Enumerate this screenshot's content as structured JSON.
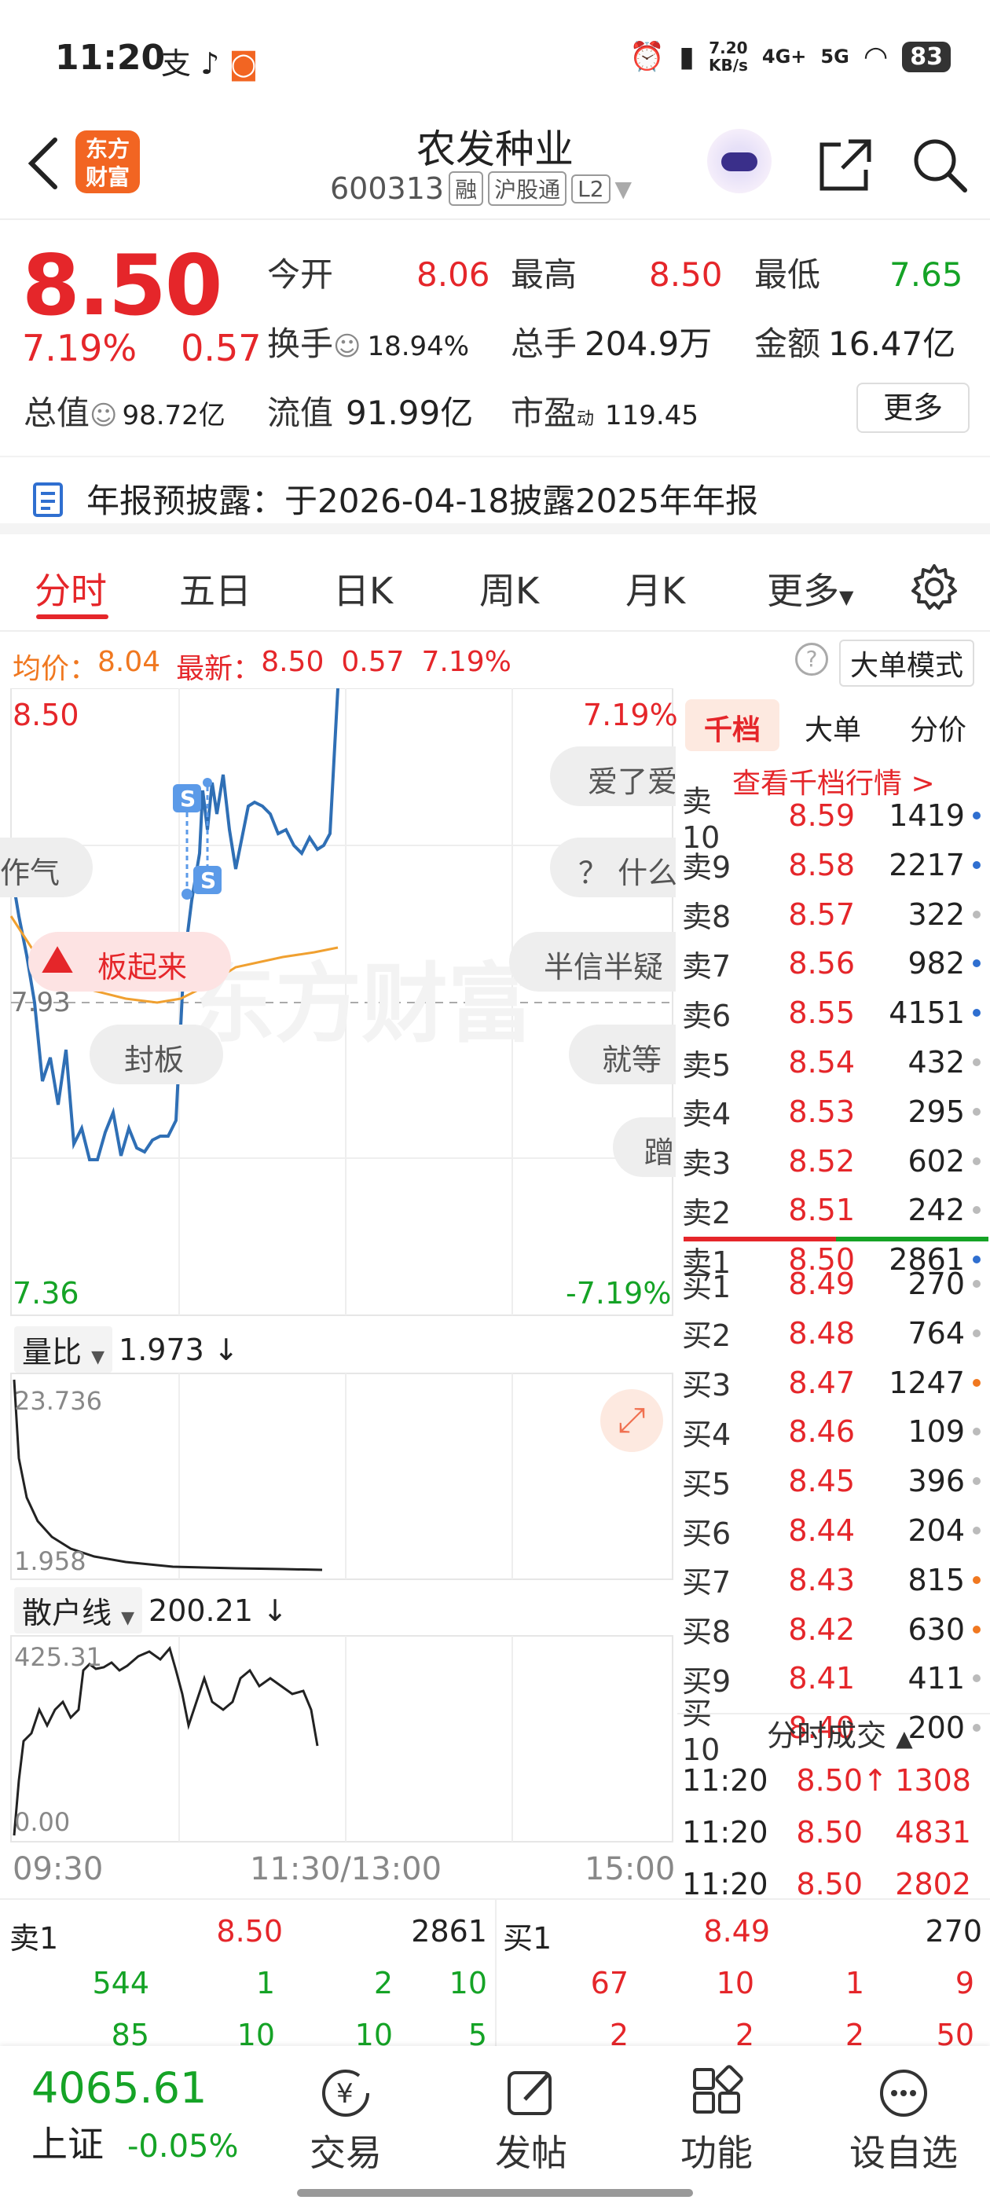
{
  "status_bar": {
    "time": "11:20",
    "speed_value": "7.20",
    "speed_unit": "KB/s",
    "net1": "4G+",
    "net2": "5G",
    "battery": "83"
  },
  "header": {
    "logo_line1": "东方",
    "logo_line2": "财富",
    "name": "农发种业",
    "code": "600313",
    "tags": [
      "融",
      "沪股通",
      "L2"
    ]
  },
  "quote": {
    "price": "8.50",
    "pct": "7.19%",
    "change": "0.57",
    "open_label": "今开",
    "open": "8.06",
    "high_label": "最高",
    "high": "8.50",
    "low_label": "最低",
    "low": "7.65",
    "turnover_label": "换手",
    "turnover": "18.94%",
    "volume_label": "总手",
    "volume": "204.9万",
    "amount_label": "金额",
    "amount": "16.47亿",
    "mktcap_label": "总值",
    "mktcap": "98.72亿",
    "float_label": "流值",
    "float": "91.99亿",
    "pe_label": "市盈",
    "pe_sup": "动",
    "pe": "119.45",
    "more": "更多"
  },
  "notice": {
    "text": "年报预披露：于2026-04-18披露2025年年报"
  },
  "tabs": [
    "分时",
    "五日",
    "日K",
    "周K",
    "月K",
    "更多"
  ],
  "avgline": {
    "avg_label": "均价：",
    "avg": "8.04",
    "latest_label": "最新：",
    "latest": "8.50",
    "change": "0.57",
    "pct": "7.19%",
    "mode": "大单模式"
  },
  "chart": {
    "price_top": "8.50",
    "pct_top": "7.19%",
    "price_bottom": "7.36",
    "pct_bottom": "-7.19%",
    "prev_close": "7.93",
    "bubbles": [
      "爱了爱",
      "作气",
      "？ 什么",
      "半信半疑",
      "板起来",
      "封板",
      "就等",
      "蹭"
    ],
    "marker_s": "S",
    "watermark": "东方财富",
    "vr_label": "量比",
    "vr_value": "1.973 ↓",
    "vr_max": "23.736",
    "vr_min": "1.958",
    "retail_label": "散户线",
    "retail_value": "200.21 ↓",
    "retail_max": "425.31",
    "retail_min": "0.00",
    "time_start": "09:30",
    "time_mid": "11:30/13:00",
    "time_end": "15:00"
  },
  "book": {
    "tabs": [
      "千档",
      "大单",
      "分价"
    ],
    "link": "查看千档行情 >",
    "sells": [
      {
        "label": "卖10",
        "price": "8.59",
        "vol": "1419",
        "dot": "blue"
      },
      {
        "label": "卖9",
        "price": "8.58",
        "vol": "2217",
        "dot": "blue"
      },
      {
        "label": "卖8",
        "price": "8.57",
        "vol": "322",
        "dot": "gray"
      },
      {
        "label": "卖7",
        "price": "8.56",
        "vol": "982",
        "dot": "blue"
      },
      {
        "label": "卖6",
        "price": "8.55",
        "vol": "4151",
        "dot": "blue"
      },
      {
        "label": "卖5",
        "price": "8.54",
        "vol": "432",
        "dot": "gray"
      },
      {
        "label": "卖4",
        "price": "8.53",
        "vol": "295",
        "dot": "gray"
      },
      {
        "label": "卖3",
        "price": "8.52",
        "vol": "602",
        "dot": "gray"
      },
      {
        "label": "卖2",
        "price": "8.51",
        "vol": "242",
        "dot": "gray"
      },
      {
        "label": "卖1",
        "price": "8.50",
        "vol": "2861",
        "dot": "blue"
      }
    ],
    "buys": [
      {
        "label": "买1",
        "price": "8.49",
        "vol": "270",
        "dot": "gray"
      },
      {
        "label": "买2",
        "price": "8.48",
        "vol": "764",
        "dot": "gray"
      },
      {
        "label": "买3",
        "price": "8.47",
        "vol": "1247",
        "dot": "orange"
      },
      {
        "label": "买4",
        "price": "8.46",
        "vol": "109",
        "dot": "gray"
      },
      {
        "label": "买5",
        "price": "8.45",
        "vol": "396",
        "dot": "gray"
      },
      {
        "label": "买6",
        "price": "8.44",
        "vol": "204",
        "dot": "gray"
      },
      {
        "label": "买7",
        "price": "8.43",
        "vol": "815",
        "dot": "orange"
      },
      {
        "label": "买8",
        "price": "8.42",
        "vol": "630",
        "dot": "orange"
      },
      {
        "label": "买9",
        "price": "8.41",
        "vol": "411",
        "dot": "gray"
      },
      {
        "label": "买10",
        "price": "8.40",
        "vol": "200",
        "dot": "gray"
      }
    ],
    "trades_title": "分时成交",
    "trades": [
      {
        "time": "11:20",
        "price": "8.50",
        "arrow": "↑",
        "vol": "1308"
      },
      {
        "time": "11:20",
        "price": "8.50",
        "arrow": "",
        "vol": "4831"
      },
      {
        "time": "11:20",
        "price": "8.50",
        "arrow": "",
        "vol": "2802"
      }
    ]
  },
  "summary": {
    "sell_label": "卖1",
    "sell_price": "8.50",
    "sell_vol": "2861",
    "buy_label": "买1",
    "buy_price": "8.49",
    "buy_vol": "270",
    "sell_row1": [
      "544",
      "1",
      "2",
      "10"
    ],
    "sell_row2": [
      "85",
      "10",
      "10",
      "5"
    ],
    "buy_row1": [
      "67",
      "10",
      "1",
      "9"
    ],
    "buy_row2": [
      "2",
      "2",
      "2",
      "50"
    ]
  },
  "bottom_nav": {
    "index_value": "4065.61",
    "index_name": "上证",
    "index_change": "-0.05%",
    "items": [
      "交易",
      "发帖",
      "功能",
      "设自选"
    ]
  }
}
